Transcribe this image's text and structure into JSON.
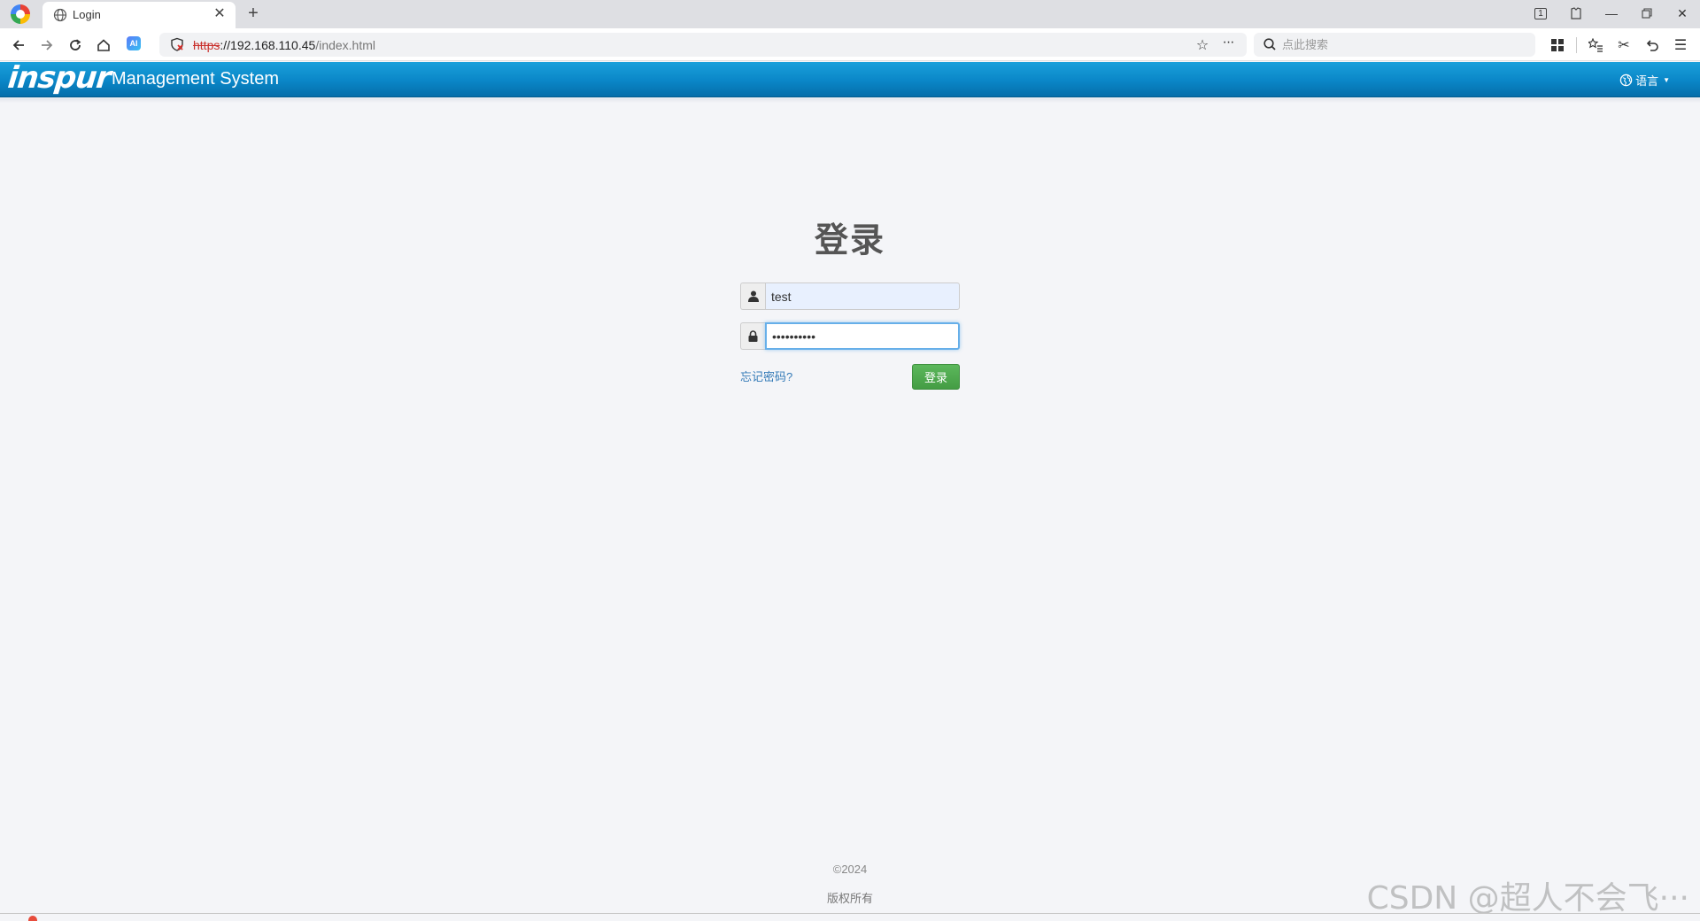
{
  "browser": {
    "tab_title": "Login",
    "url_protocol": "https",
    "url_host": "://192.168.110.45",
    "url_path": "/index.html",
    "search_placeholder": "点此搜索",
    "ai_badge": "AI",
    "tab_count": "1"
  },
  "header": {
    "brand": "inspur",
    "title": "Management System",
    "language_label": "语言"
  },
  "login": {
    "title": "登录",
    "username_value": "test",
    "password_value": "••••••••••",
    "forgot_password": "忘记密码?",
    "submit_label": "登录"
  },
  "footer": {
    "copyright": "©2024",
    "rights": "版权所有"
  },
  "watermark": "CSDN @超人不会飞···",
  "colors": {
    "header_blue": "#0a86c7",
    "login_green": "#5cb85c",
    "link_blue": "#337ab7"
  }
}
